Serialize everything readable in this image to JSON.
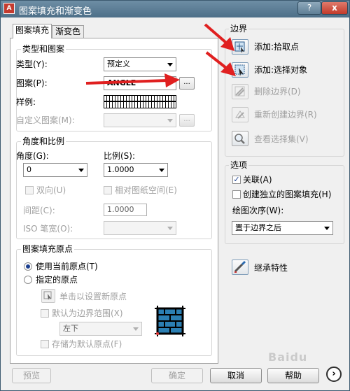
{
  "window": {
    "title": "图案填充和渐变色",
    "help_btn": "?",
    "close_btn": "x"
  },
  "tabs": [
    {
      "label": "图案填充",
      "active": true
    },
    {
      "label": "渐变色",
      "active": false
    }
  ],
  "type_pattern": {
    "group_label": "类型和图案",
    "type_label": "类型(Y):",
    "type_value": "预定义",
    "pattern_label": "图案(P):",
    "pattern_value": "ANGLE",
    "pattern_browse": "...",
    "sample_label": "样例:",
    "custom_label": "自定义图案(M):",
    "custom_value": "",
    "custom_browse": "..."
  },
  "angle_scale": {
    "group_label": "角度和比例",
    "angle_label": "角度(G):",
    "angle_value": "0",
    "scale_label": "比例(S):",
    "scale_value": "1.0000",
    "double_label": "双向(U)",
    "relative_label": "相对图纸空间(E)",
    "spacing_label": "间距(C):",
    "spacing_value": "1.0000",
    "iso_label": "ISO 笔宽(O):",
    "iso_value": ""
  },
  "origin": {
    "group_label": "图案填充原点",
    "use_current": "使用当前原点(T)",
    "specified": "指定的原点",
    "click_set": "单击以设置新原点",
    "default_boundary": "默认为边界范围(X)",
    "position_value": "左下",
    "store_default": "存储为默认原点(F)"
  },
  "boundaries": {
    "group_label": "边界",
    "add_pick": "添加:拾取点",
    "add_select": "添加:选择对象",
    "remove": "删除边界(D)",
    "recreate": "重新创建边界(R)",
    "view_selection": "查看选择集(V)"
  },
  "options": {
    "group_label": "选项",
    "associative": "关联(A)",
    "associative_checked": true,
    "separate": "创建独立的图案填充(H)",
    "separate_checked": false,
    "draw_order_label": "绘图次序(W):",
    "draw_order_value": "置于边界之后"
  },
  "inherit": "继承特性",
  "buttons": {
    "preview": "预览",
    "ok": "确定",
    "cancel": "取消",
    "help": "帮助"
  },
  "watermark": "Baidu",
  "colors": {
    "arrow": "#e02020",
    "title_bar": "#5a7b93",
    "selection": "#1b3f8f"
  },
  "icons": [
    "app-icon",
    "pick-points-icon",
    "select-objects-icon",
    "remove-boundary-icon",
    "recreate-boundary-icon",
    "view-selection-icon",
    "inherit-properties-icon",
    "set-origin-icon",
    "hatch-preview-icon",
    "expand-icon"
  ]
}
